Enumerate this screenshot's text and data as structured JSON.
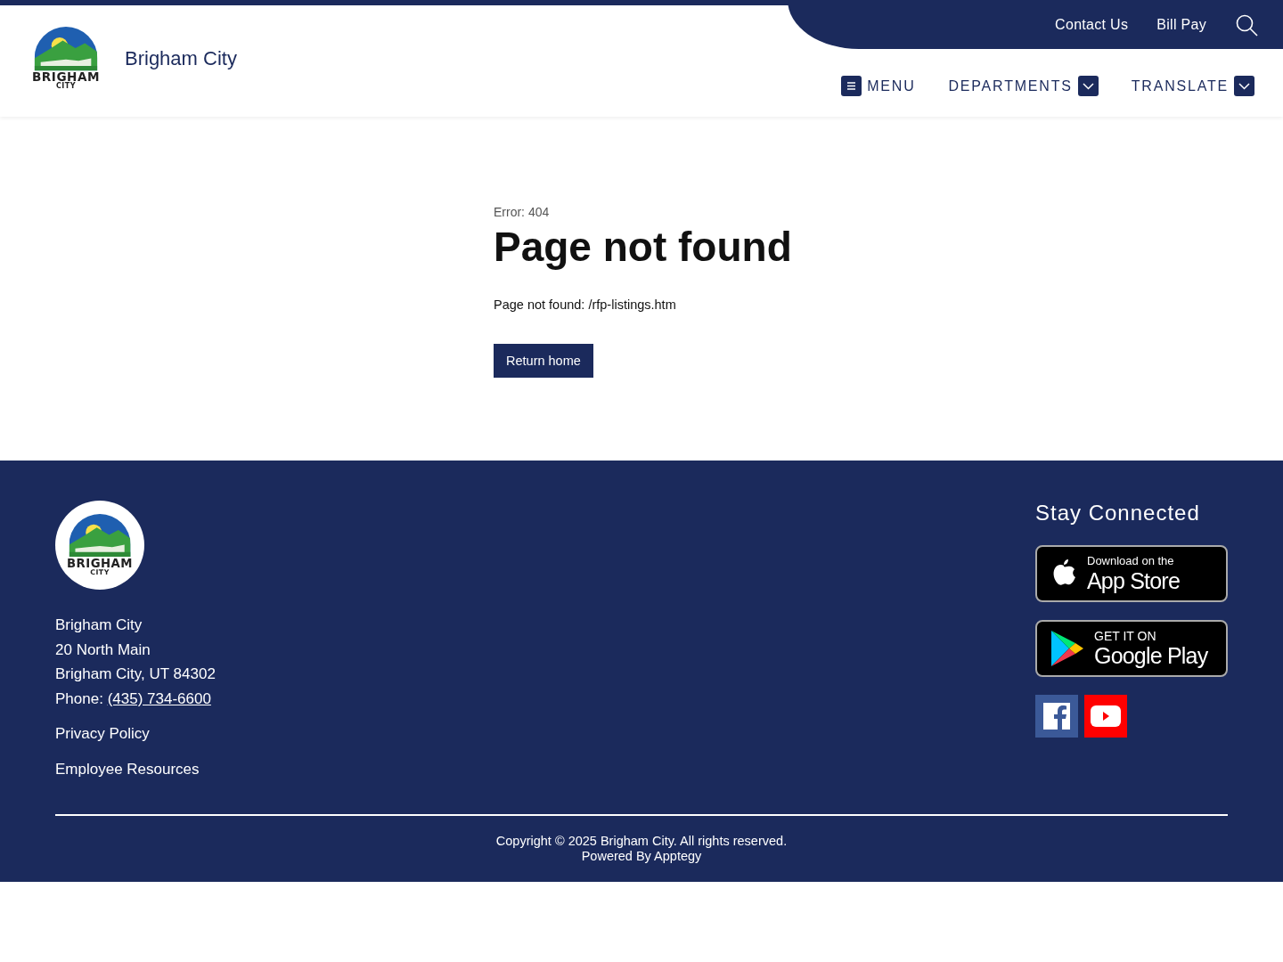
{
  "header": {
    "logo": {
      "line_1": "BRIGHAM",
      "line_2": "CITY"
    },
    "site_title": "Brigham City",
    "utility_links": [
      "Contact Us",
      "Bill Pay"
    ],
    "nav": [
      {
        "label": "MENU",
        "kind": "menu"
      },
      {
        "label": "DEPARTMENTS",
        "kind": "dropdown"
      },
      {
        "label": "TRANSLATE",
        "kind": "dropdown"
      }
    ]
  },
  "main": {
    "error_code": "Error: 404",
    "heading": "Page not found",
    "message": "Page not found: /rfp-listings.htm",
    "button": "Return home"
  },
  "footer": {
    "logo": {
      "line_1": "BRIGHAM",
      "line_2": "CITY"
    },
    "address": [
      "Brigham City",
      "20 North Main",
      "Brigham City, UT 84302"
    ],
    "phone_label": "Phone:",
    "phone": "(435) 734-6600",
    "links": [
      "Privacy Policy",
      "Employee Resources"
    ],
    "stay_connected": "Stay Connected",
    "app_badges": [
      {
        "kind": "apple",
        "small": "Download on the",
        "big": "App Store"
      },
      {
        "kind": "google",
        "small": "GET IT ON",
        "big": "Google Play"
      }
    ],
    "social": [
      {
        "kind": "facebook"
      },
      {
        "kind": "youtube"
      }
    ],
    "copyright": "Copyright © 2025 Brigham City. All rights reserved.",
    "powered": "Powered By Apptegy"
  }
}
